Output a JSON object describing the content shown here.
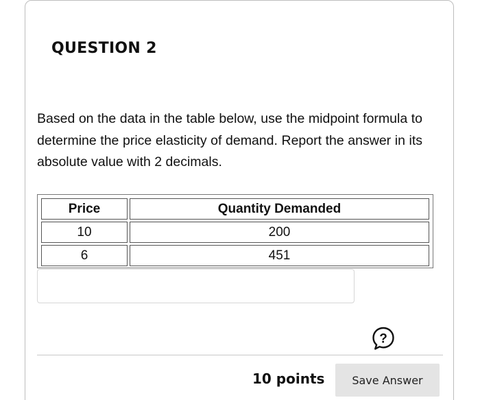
{
  "question": {
    "title": "QUESTION 2",
    "text": "Based on the data in the table below, use the midpoint formula to determine the price elasticity of demand. Report the answer in its absolute value with 2 decimals."
  },
  "table": {
    "headers": [
      "Price",
      "Quantity Demanded"
    ],
    "rows": [
      [
        "10",
        "200"
      ],
      [
        "6",
        "451"
      ]
    ]
  },
  "answer": {
    "value": "",
    "placeholder": ""
  },
  "help_icon": "question-circle-icon",
  "footer": {
    "points": "10 points",
    "save_label": "Save Answer"
  }
}
